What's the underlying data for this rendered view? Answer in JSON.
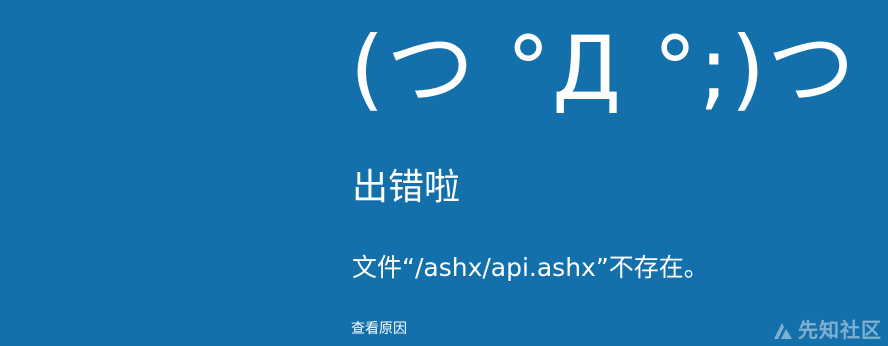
{
  "error_page": {
    "emoticon": "(つ °Д °;)つ",
    "title": "出错啦",
    "message": "文件“/ashx/api.ashx”不存在。",
    "details_link": "查看原因"
  },
  "watermark": {
    "text": "先知社区"
  },
  "colors": {
    "background": "#1470ab",
    "text": "#ffffff"
  }
}
